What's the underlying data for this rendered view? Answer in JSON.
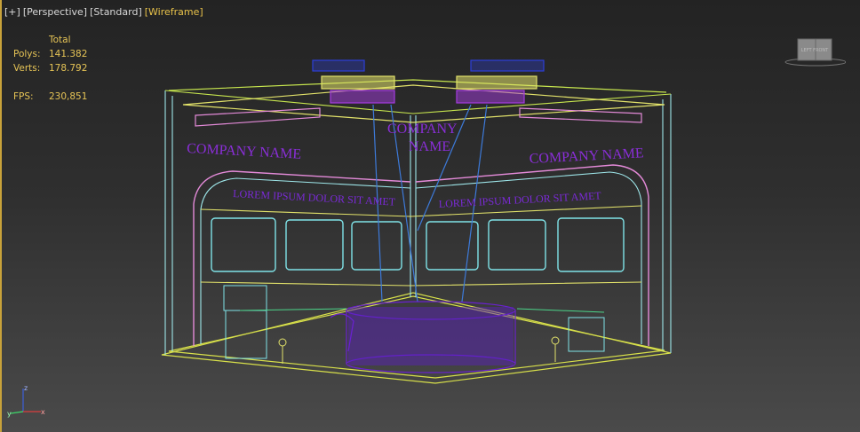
{
  "viewport_menu": {
    "plus": "[+]",
    "view": "[Perspective]",
    "shading": "[Standard]",
    "mode": "[Wireframe]"
  },
  "stats": {
    "header": "Total",
    "polys_label": "Polys:",
    "polys_value": "141.382",
    "verts_label": "Verts:",
    "verts_value": "178.792",
    "fps_label": "FPS:",
    "fps_value": "230,851"
  },
  "scene_text": {
    "company_name_left": "COMPANY NAME",
    "company_name_right": "COMPANY NAME",
    "company_center_line1": "COMPANY",
    "company_center_line2": "NAME",
    "lorem_left": "LOREM IPSUM DOLOR SIT AMET",
    "lorem_right": "LOREM IPSUM DOLOR SIT AMET"
  },
  "viewcube": {
    "label": "LEFT FRONT"
  },
  "gizmo": {
    "z": "z",
    "y": "y",
    "x": "x"
  },
  "colors": {
    "accent_yellow": "#e6c456",
    "wire_cyan": "#7fe3e8",
    "wire_purple": "#7a2ad6",
    "wire_pink": "#e38ad8",
    "wire_yellow": "#e2e26a",
    "wire_blue": "#2d3fd9"
  }
}
